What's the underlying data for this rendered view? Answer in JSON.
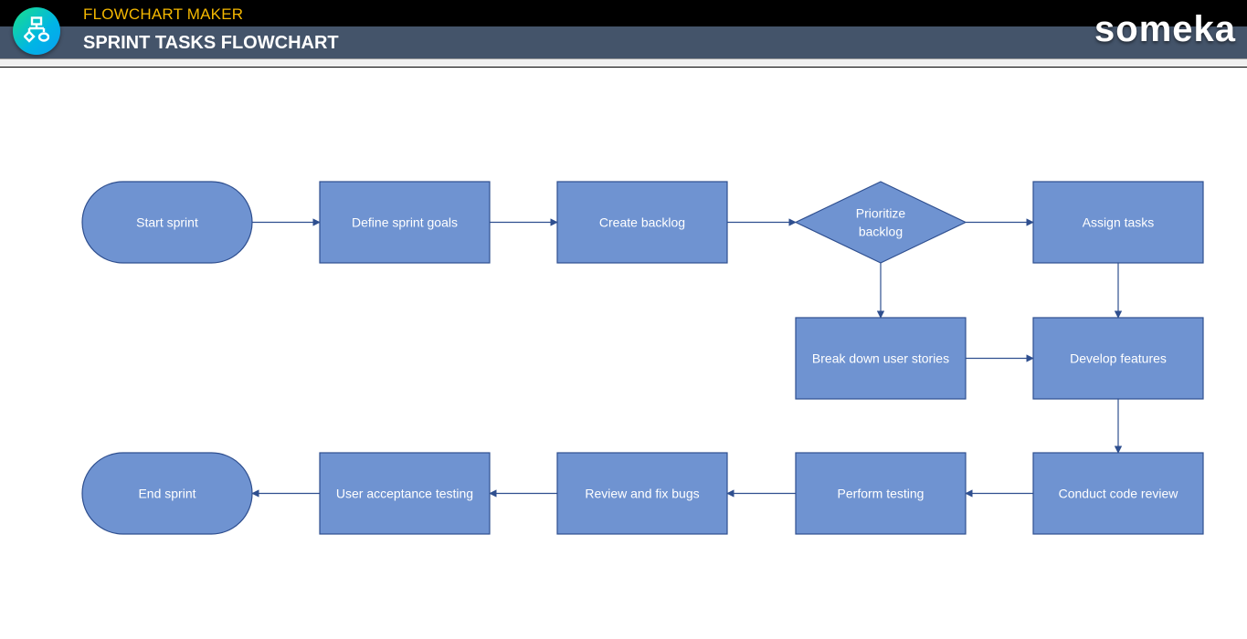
{
  "header": {
    "app_title": "FLOWCHART MAKER",
    "page_title": "SPRINT TASKS FLOWCHART",
    "brand": "someka",
    "logo_icon": "flowchart-icon"
  },
  "colors": {
    "node_fill": "#6f93d1",
    "node_stroke": "#2f4f8f",
    "connector": "#2f4f8f",
    "app_title": "#f5b800",
    "header_band": "#44546a"
  },
  "flowchart": {
    "nodes": [
      {
        "id": "start",
        "label": "Start sprint",
        "shape": "terminator"
      },
      {
        "id": "goals",
        "label": "Define sprint goals",
        "shape": "process"
      },
      {
        "id": "backlog",
        "label": "Create backlog",
        "shape": "process"
      },
      {
        "id": "prioritize",
        "label": "Prioritize backlog",
        "lines": [
          "Prioritize",
          "backlog"
        ],
        "shape": "decision"
      },
      {
        "id": "assign",
        "label": "Assign tasks",
        "shape": "process"
      },
      {
        "id": "breakdown",
        "label": "Break down user stories",
        "shape": "process"
      },
      {
        "id": "develop",
        "label": "Develop features",
        "shape": "process"
      },
      {
        "id": "codereview",
        "label": "Conduct code review",
        "shape": "process"
      },
      {
        "id": "testing",
        "label": "Perform testing",
        "shape": "process"
      },
      {
        "id": "bugs",
        "label": "Review and fix bugs",
        "shape": "process"
      },
      {
        "id": "uat",
        "label": "User acceptance testing",
        "shape": "process"
      },
      {
        "id": "end",
        "label": "End sprint",
        "shape": "terminator"
      }
    ],
    "edges": [
      {
        "from": "start",
        "to": "goals"
      },
      {
        "from": "goals",
        "to": "backlog"
      },
      {
        "from": "backlog",
        "to": "prioritize"
      },
      {
        "from": "prioritize",
        "to": "assign"
      },
      {
        "from": "prioritize",
        "to": "breakdown"
      },
      {
        "from": "assign",
        "to": "develop"
      },
      {
        "from": "breakdown",
        "to": "develop"
      },
      {
        "from": "develop",
        "to": "codereview"
      },
      {
        "from": "codereview",
        "to": "testing"
      },
      {
        "from": "testing",
        "to": "bugs"
      },
      {
        "from": "bugs",
        "to": "uat"
      },
      {
        "from": "uat",
        "to": "end"
      }
    ]
  }
}
